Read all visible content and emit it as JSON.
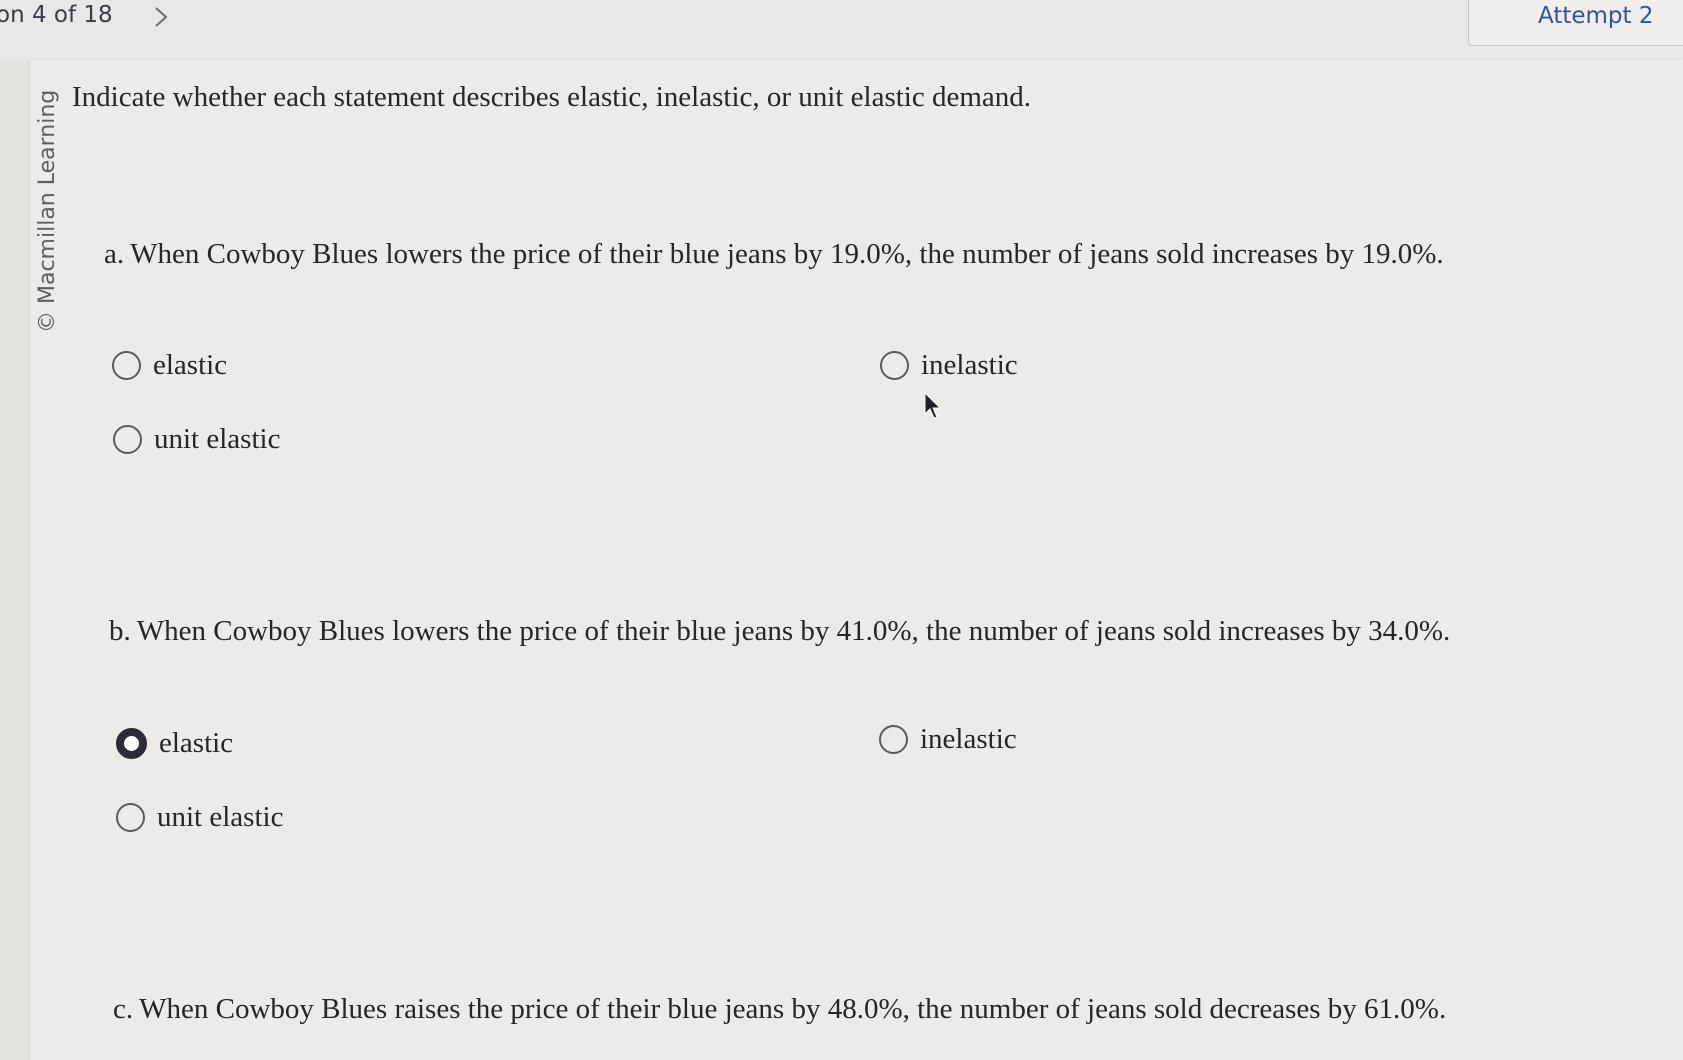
{
  "nav": {
    "question_counter": "on 4 of 18",
    "next_icon": "chevron-right-icon",
    "attempt_label": "Attempt 2"
  },
  "credit": "© Macmillan Learning",
  "instruction": "Indicate whether each statement describes elastic, inelastic, or unit elastic demand.",
  "questions": [
    {
      "letter": "a.",
      "text": "When Cowboy Blues lowers the price of their blue jeans by 19.0%, the number of jeans sold increases by 19.0%.",
      "options": [
        {
          "label": "elastic",
          "selected": false
        },
        {
          "label": "inelastic",
          "selected": false
        },
        {
          "label": "unit elastic",
          "selected": false
        }
      ]
    },
    {
      "letter": "b.",
      "text": "When Cowboy Blues lowers the price of their blue jeans by 41.0%, the number of jeans sold increases by 34.0%.",
      "options": [
        {
          "label": "elastic",
          "selected": true
        },
        {
          "label": "inelastic",
          "selected": false
        },
        {
          "label": "unit elastic",
          "selected": false
        }
      ]
    },
    {
      "letter": "c.",
      "text": "When Cowboy Blues raises the price of their blue jeans by 48.0%, the number of jeans sold decreases by 61.0%."
    }
  ],
  "colors": {
    "accent": "#2c5696",
    "selected_radio": "#2b2c3a"
  }
}
